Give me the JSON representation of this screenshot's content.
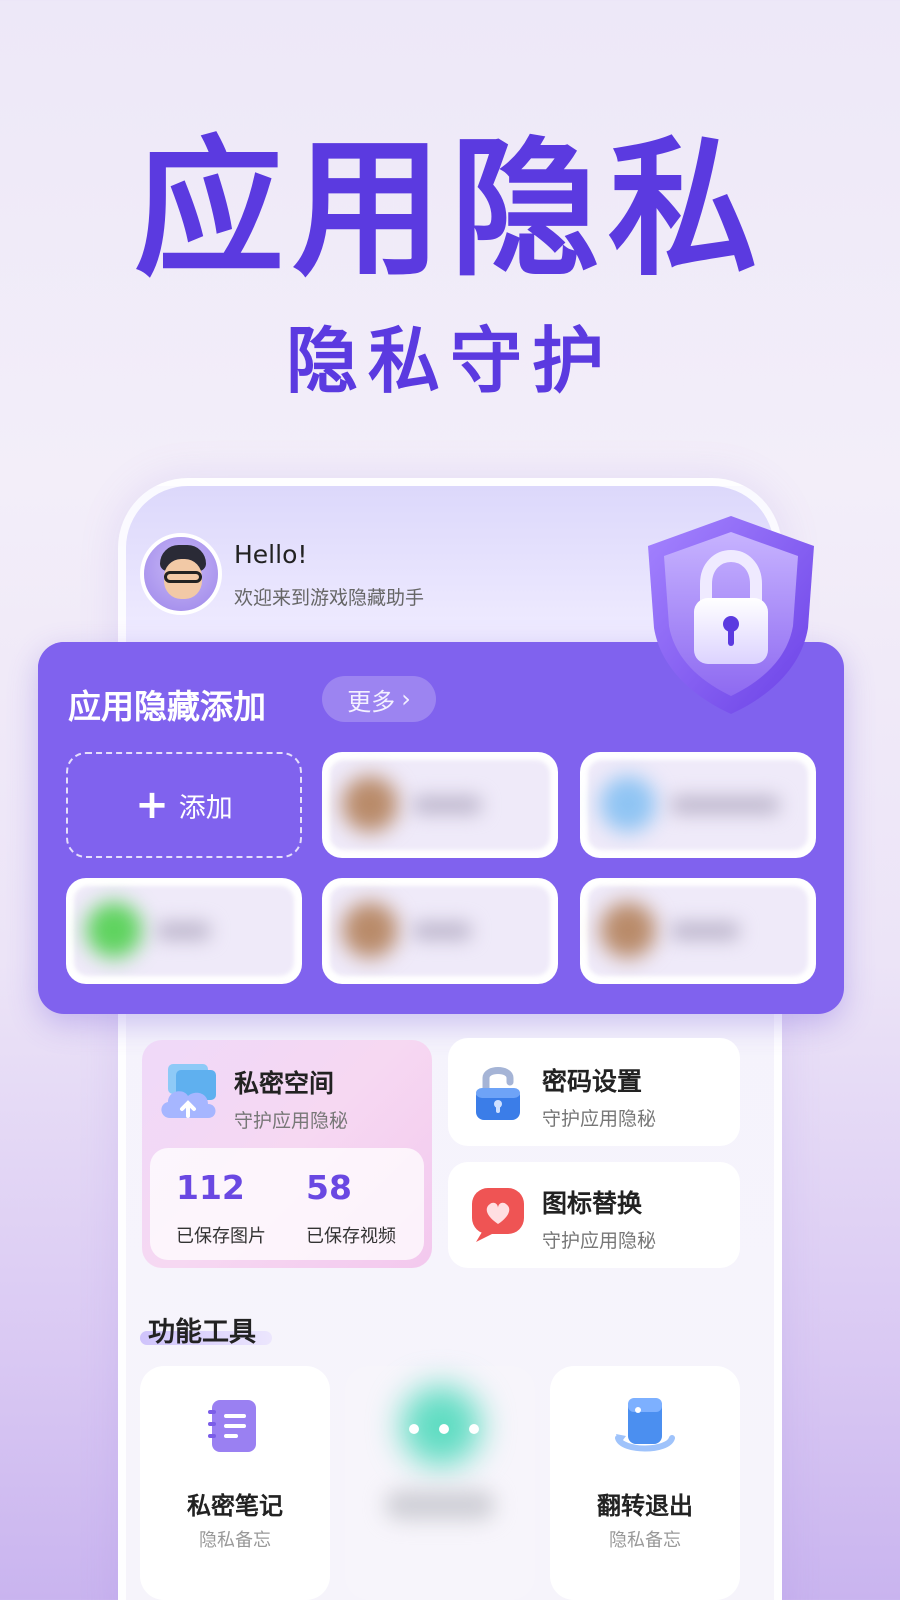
{
  "hero": {
    "title": "应用隐私",
    "subtitle": "隐私守护"
  },
  "header": {
    "greeting": "Hello!",
    "welcome": "欢迎来到游戏隐藏助手"
  },
  "app_hide": {
    "title": "应用隐藏添加",
    "more_label": "更多",
    "add_label": "添加",
    "slots": [
      {
        "blob_color": "#b98b6a",
        "bar_width": 70
      },
      {
        "blob_color": "#8fc4f3",
        "bar_width": 110
      },
      {
        "blob_color": "#5fd35f",
        "bar_width": 55
      },
      {
        "blob_color": "#b98b6a",
        "bar_width": 60
      },
      {
        "blob_color": "#b98b6a",
        "bar_width": 70
      }
    ]
  },
  "features": {
    "private_space": {
      "title": "私密空间",
      "subtitle": "守护应用隐秘",
      "photos_count": "112",
      "photos_label": "已保存图片",
      "videos_count": "58",
      "videos_label": "已保存视频"
    },
    "password": {
      "title": "密码设置",
      "subtitle": "守护应用隐秘"
    },
    "icon_replace": {
      "title": "图标替换",
      "subtitle": "守护应用隐秘"
    }
  },
  "tools": {
    "section_title": "功能工具",
    "items": [
      {
        "name": "私密笔记",
        "sub": "隐私备忘"
      },
      {
        "name": "",
        "sub": ""
      },
      {
        "name": "翻转退出",
        "sub": "隐私备忘"
      }
    ]
  },
  "colors": {
    "brand": "#5b3ae0",
    "card": "#8062ee"
  }
}
